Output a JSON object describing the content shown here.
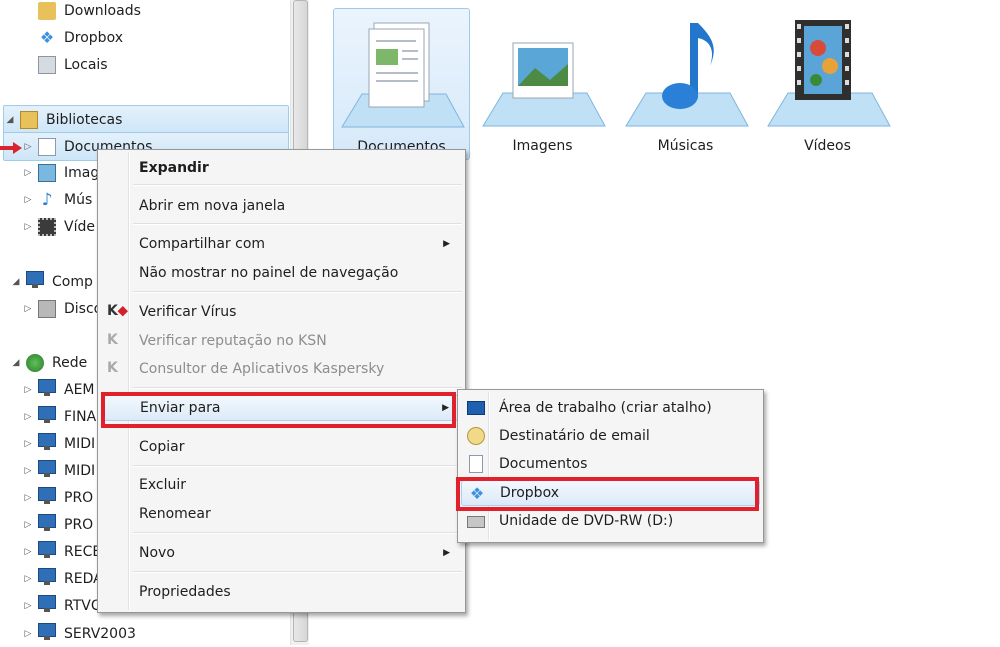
{
  "nav": {
    "items": [
      {
        "label": "Downloads"
      },
      {
        "label": "Dropbox"
      },
      {
        "label": "Locais"
      },
      {
        "label": "Bibliotecas"
      },
      {
        "label": "Documentos"
      },
      {
        "label": "Imag"
      },
      {
        "label": "Mús"
      },
      {
        "label": "Víde"
      },
      {
        "label": "Comp"
      },
      {
        "label": "Disco"
      },
      {
        "label": "Rede"
      },
      {
        "label": "AEM"
      },
      {
        "label": "FINA"
      },
      {
        "label": "MIDI"
      },
      {
        "label": "MIDI"
      },
      {
        "label": "PRO"
      },
      {
        "label": "PRO"
      },
      {
        "label": "RECE"
      },
      {
        "label": "REDA"
      },
      {
        "label": "RTVC-PC"
      },
      {
        "label": "SERV2003"
      }
    ]
  },
  "libraries": [
    {
      "label": "Documentos"
    },
    {
      "label": "Imagens"
    },
    {
      "label": "Músicas"
    },
    {
      "label": "Vídeos"
    }
  ],
  "context_menu": {
    "items": [
      {
        "label": "Expandir"
      },
      {
        "label": "Abrir em nova janela"
      },
      {
        "label": "Compartilhar com"
      },
      {
        "label": "Não mostrar no painel de navegação"
      },
      {
        "label": "Verificar Vírus"
      },
      {
        "label": "Verificar reputação no KSN"
      },
      {
        "label": "Consultor de Aplicativos Kaspersky"
      },
      {
        "label": "Enviar para"
      },
      {
        "label": "Copiar"
      },
      {
        "label": "Excluir"
      },
      {
        "label": "Renomear"
      },
      {
        "label": "Novo"
      },
      {
        "label": "Propriedades"
      }
    ]
  },
  "submenu": {
    "items": [
      {
        "label": "Área de trabalho (criar atalho)"
      },
      {
        "label": "Destinatário de email"
      },
      {
        "label": "Documentos"
      },
      {
        "label": "Dropbox"
      },
      {
        "label": "Unidade de DVD-RW (D:)"
      }
    ]
  },
  "colors": {
    "highlight_box": "#e0202a",
    "selection_bg": "#cde6f8",
    "annotation_arrow": "#d9232d"
  }
}
